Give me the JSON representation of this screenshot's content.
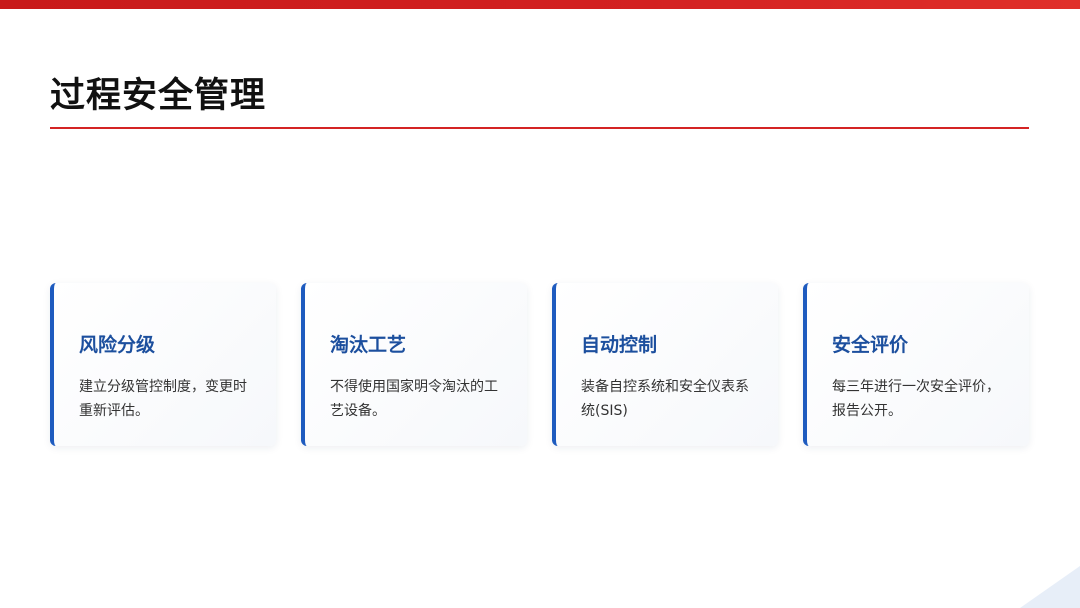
{
  "slide": {
    "title": "过程安全管理",
    "accent_color": "#d42424",
    "card_accent_color": "#1e5bbf",
    "card_title_color": "#1c4f9e"
  },
  "cards": [
    {
      "title": "风险分级",
      "text": "建立分级管控制度，变更时重新评估。"
    },
    {
      "title": "淘汰工艺",
      "text": "不得使用国家明令淘汰的工艺设备。"
    },
    {
      "title": "自动控制",
      "text": "装备自控系统和安全仪表系统(SIS)"
    },
    {
      "title": "安全评价",
      "text": "每三年进行一次安全评价，报告公开。"
    }
  ]
}
